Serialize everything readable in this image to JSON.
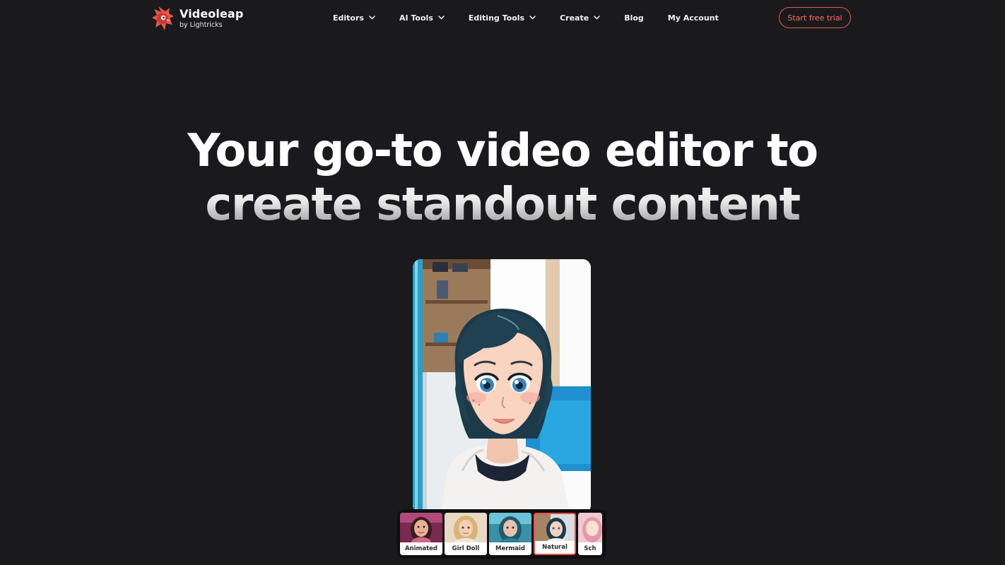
{
  "brand": {
    "name": "Videoleap",
    "byline": "by Lightricks",
    "accent": "#e8564a",
    "icon": "videoleap-logo-icon"
  },
  "nav": {
    "items": [
      {
        "label": "Editors",
        "has_dropdown": true
      },
      {
        "label": "AI Tools",
        "has_dropdown": true
      },
      {
        "label": "Editing Tools",
        "has_dropdown": true
      },
      {
        "label": "Create",
        "has_dropdown": true
      },
      {
        "label": "Blog",
        "has_dropdown": false
      },
      {
        "label": "My Account",
        "has_dropdown": false
      }
    ],
    "dropdown_icon": "chevron-down-icon"
  },
  "cta": {
    "label": "Start free trial",
    "color": "#ff6b5e"
  },
  "hero": {
    "line1": "Your go-to video editor to",
    "line2": "create standout content"
  },
  "styles": {
    "items": [
      {
        "label": "Animated",
        "selected": false
      },
      {
        "label": "Girl Doll",
        "selected": false
      },
      {
        "label": "Mermaid",
        "selected": false
      },
      {
        "label": "Natural",
        "selected": true
      },
      {
        "label": "Sch",
        "selected": false
      }
    ]
  },
  "colors": {
    "background": "#1a1a1d",
    "text": "#ffffff"
  }
}
